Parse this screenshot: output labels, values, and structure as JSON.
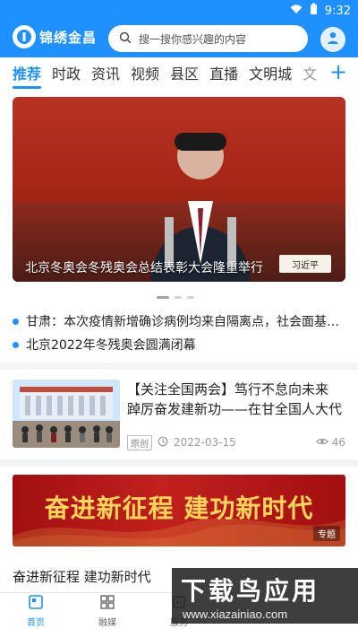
{
  "status_bar": {
    "time": "9:32"
  },
  "header": {
    "logo_text": "锦绣金昌",
    "search_placeholder": "搜一搜你感兴趣的内容",
    "brand_color": "#1e90ff"
  },
  "tabs": {
    "items": [
      "推荐",
      "时政",
      "资讯",
      "视频",
      "县区",
      "直播",
      "文明城",
      "文"
    ],
    "active_index": 0,
    "add_icon": "plus-icon"
  },
  "hero": {
    "caption": "北京冬奥会冬残奥会总结表彰大会隆重举行",
    "nameplate": "习近平",
    "dots_active_index": 0,
    "dots_count": 3
  },
  "news_list": [
    "甘肃：本次疫情新增确诊病例均来自隔离点，社会面基本清零",
    "北京2022年冬残奥会圆满闭幕"
  ],
  "article": {
    "title": "【关注全国两会】笃行不怠向未来 踔厉奋发建新功——在甘全国人大代表热议政府工作报告",
    "tag": "原创",
    "date": "2022-03-15",
    "views": "46"
  },
  "banner": {
    "headline": "奋进新征程 建功新时代",
    "tag": "专题",
    "title": "奋进新征程 建功新时代"
  },
  "bottom_nav": {
    "items": [
      {
        "label": "首页",
        "icon": "home-icon"
      },
      {
        "label": "融媒",
        "icon": "grid-icon"
      },
      {
        "label": "服务",
        "icon": "service-icon"
      },
      {
        "label": "",
        "icon": ""
      },
      {
        "label": "",
        "icon": ""
      }
    ],
    "active_index": 0
  },
  "watermark": {
    "big": "下载鸟应用",
    "small": "www.xiazainiao.com"
  }
}
